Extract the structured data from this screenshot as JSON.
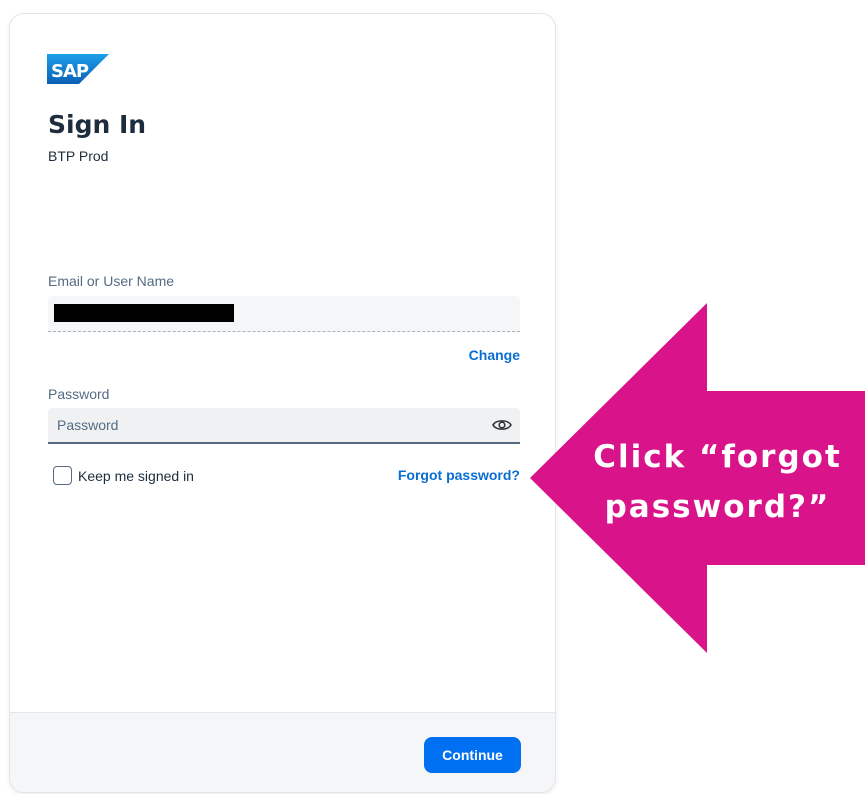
{
  "brand": {
    "logo_text": "SAP",
    "logo_colors": [
      "#1ea0e8",
      "#0a5fb5"
    ]
  },
  "header": {
    "title": "Sign In",
    "subtitle": "BTP Prod"
  },
  "form": {
    "email_label": "Email or User Name",
    "email_value_redacted": true,
    "change_link": "Change",
    "password_label": "Password",
    "password_placeholder": "Password",
    "password_value": "",
    "show_password_icon": "eye-icon",
    "keep_signed_in_label": "Keep me signed in",
    "keep_signed_in_checked": false,
    "forgot_password_link": "Forgot password?"
  },
  "footer": {
    "continue_label": "Continue"
  },
  "annotation": {
    "text": "Click “forgot\npassword?”",
    "color": "#d9138a"
  },
  "colors": {
    "accent": "#0070f2",
    "link": "#0a6ed1"
  }
}
